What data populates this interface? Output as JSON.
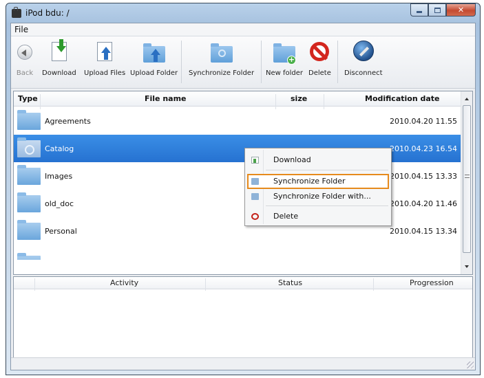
{
  "window": {
    "title": "iPod bdu: /"
  },
  "menubar": {
    "file": "File"
  },
  "toolbar": {
    "back": "Back",
    "download": "Download",
    "upload_files": "Upload Files",
    "upload_folder": "Upload Folder",
    "synchronize_folder": "Synchronize Folder",
    "new_folder": "New folder",
    "delete": "Delete",
    "disconnect": "Disconnect"
  },
  "file_list": {
    "columns": {
      "type": "Type",
      "file_name": "File name",
      "size": "size",
      "modification_date": "Modification date"
    },
    "rows": [
      {
        "name": "Agreements",
        "size": "",
        "date": "2010.04.20 11.55"
      },
      {
        "name": "Catalog",
        "size": "",
        "date": "2010.04.23 16.54",
        "selected": true
      },
      {
        "name": "Images",
        "size": "",
        "date": "2010.04.15 13.33"
      },
      {
        "name": "old_doc",
        "size": "",
        "date": "2010.04.20 11.46"
      },
      {
        "name": "Personal",
        "size": "",
        "date": "2010.04.15 13.34"
      }
    ]
  },
  "context_menu": {
    "items": [
      {
        "label": "Download",
        "icon": "download-icon"
      },
      {
        "label": "Synchronize Folder",
        "icon": "sync-folder-icon",
        "highlighted": true
      },
      {
        "label": "Synchronize Folder with...",
        "icon": "sync-folder-with-icon"
      },
      {
        "label": "Delete",
        "icon": "delete-icon"
      }
    ]
  },
  "activity": {
    "columns": {
      "activity": "Activity",
      "status": "Status",
      "progression": "Progression"
    }
  },
  "colors": {
    "selection": "#2a78d6",
    "highlight_border": "#e68a1c"
  }
}
